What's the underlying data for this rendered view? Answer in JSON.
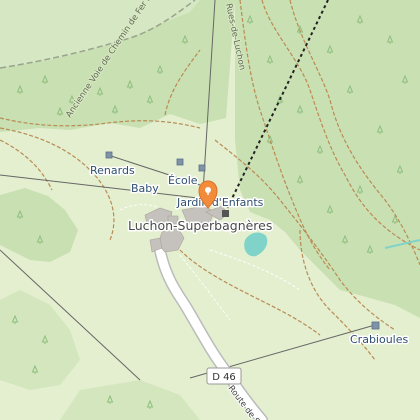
{
  "map": {
    "colors": {
      "forest": "#c9e0b2",
      "meadow": "#e3efcf",
      "building": "#c5c1bd",
      "water": "#7fd3c8",
      "marker": "#f28c3a",
      "track": "#b98b53",
      "aerialway": "#555555"
    },
    "places": {
      "resort": "Luchon-Superbagnères",
      "renards": "Renards",
      "baby": "Baby",
      "ecole": "École",
      "jardin": "Jardin d'Enfants",
      "crabioules": "Crabioules"
    },
    "roads": {
      "shield": "D 46",
      "route_label": "Route de S",
      "rail_label": "Ancienne Voie de Chemin de Fer à Crémaillère",
      "street_label": "Rues-de-Luchon"
    },
    "marker": {
      "icon": "location-pin-icon"
    }
  }
}
